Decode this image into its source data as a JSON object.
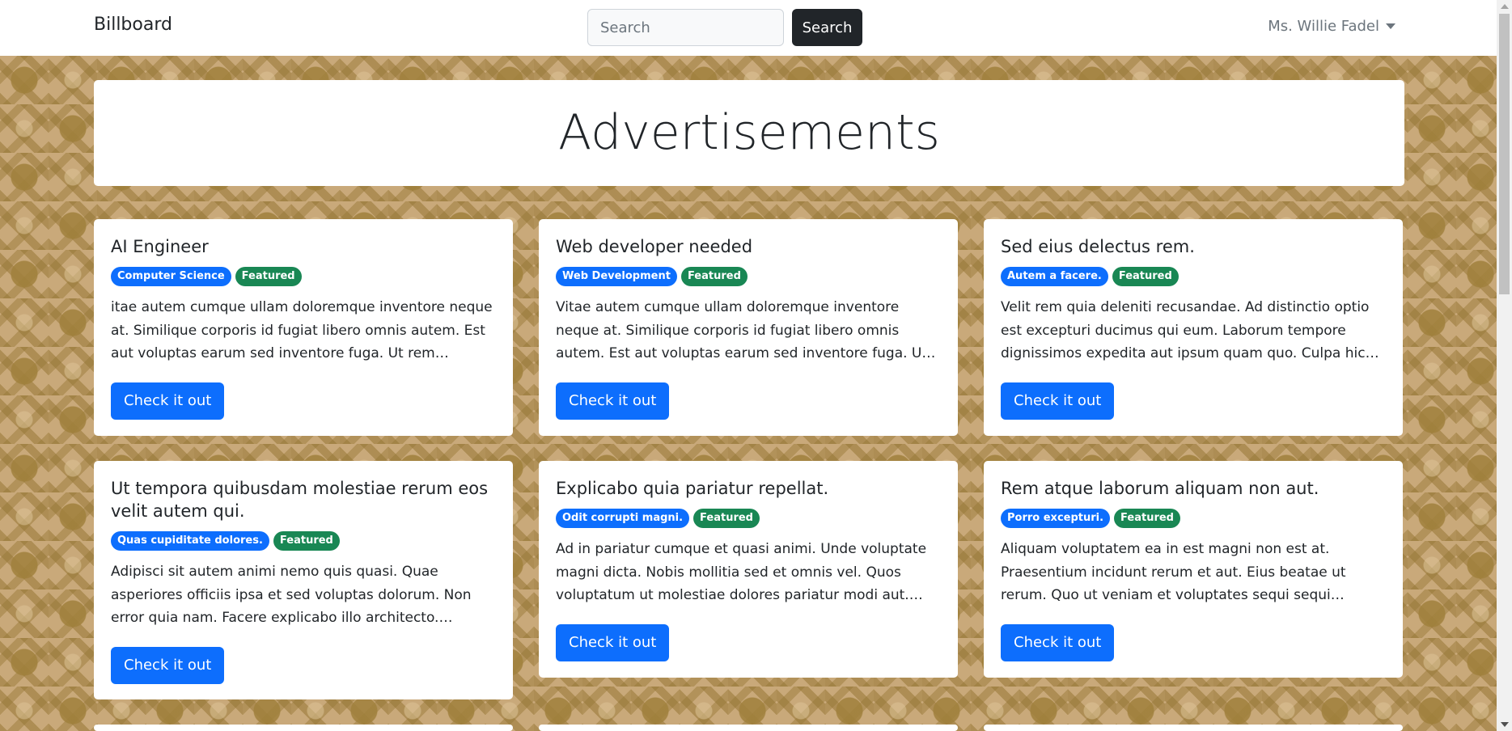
{
  "navbar": {
    "brand": "Billboard",
    "search_placeholder": "Search",
    "search_button": "Search",
    "user_name": "Ms. Willie Fadel"
  },
  "hero": {
    "title": "Advertisements"
  },
  "colors": {
    "primary": "#0d6efd",
    "success": "#198754",
    "dark": "#212529",
    "background": "#c9a97a"
  },
  "cards": [
    {
      "title": "AI Engineer",
      "category": "Computer Science",
      "featured": "Featured",
      "description": "itae autem cumque ullam doloremque inventore neque at. Similique corporis id fugiat libero omnis autem. Est aut voluptas earum sed inventore fuga. Ut rem voluptas odit...",
      "cta": "Check it out"
    },
    {
      "title": "Web developer needed",
      "category": "Web Development",
      "featured": "Featured",
      "description": "Vitae autem cumque ullam doloremque inventore neque at. Similique corporis id fugiat libero omnis autem. Est aut voluptas earum sed inventore fuga. Ut rem voluptas odit...",
      "cta": "Check it out"
    },
    {
      "title": "Sed eius delectus rem.",
      "category": "Autem a facere.",
      "featured": "Featured",
      "description": "Velit rem quia deleniti recusandae. Ad distinctio optio est excepturi ducimus qui eum. Laborum tempore dignissimos expedita aut ipsum quam quo. Culpa hic reprehenderit...",
      "cta": "Check it out"
    },
    {
      "title": "Ut tempora quibusdam molestiae rerum eos velit autem qui.",
      "category": "Quas cupiditate dolores.",
      "featured": "Featured",
      "description": "Adipisci sit autem animi nemo quis quasi. Quae asperiores officiis ipsa et sed voluptas dolorum. Non error quia nam. Facere explicabo illo architecto. Doloremque accusantium...",
      "cta": "Check it out"
    },
    {
      "title": "Explicabo quia pariatur repellat.",
      "category": "Odit corrupti magni.",
      "featured": "Featured",
      "description": "Ad in pariatur cumque et quasi animi. Unde voluptate magni dicta. Nobis mollitia sed et omnis vel. Quos voluptatum ut molestiae dolores pariatur modi aut. Unde...",
      "cta": "Check it out"
    },
    {
      "title": "Rem atque laborum aliquam non aut.",
      "category": "Porro excepturi.",
      "featured": "Featured",
      "description": "Aliquam voluptatem ea in est magni non est at. Praesentium incidunt rerum et aut. Eius beatae ut rerum. Quo ut veniam et voluptates sequi sequi temporibus....",
      "cta": "Check it out"
    }
  ]
}
